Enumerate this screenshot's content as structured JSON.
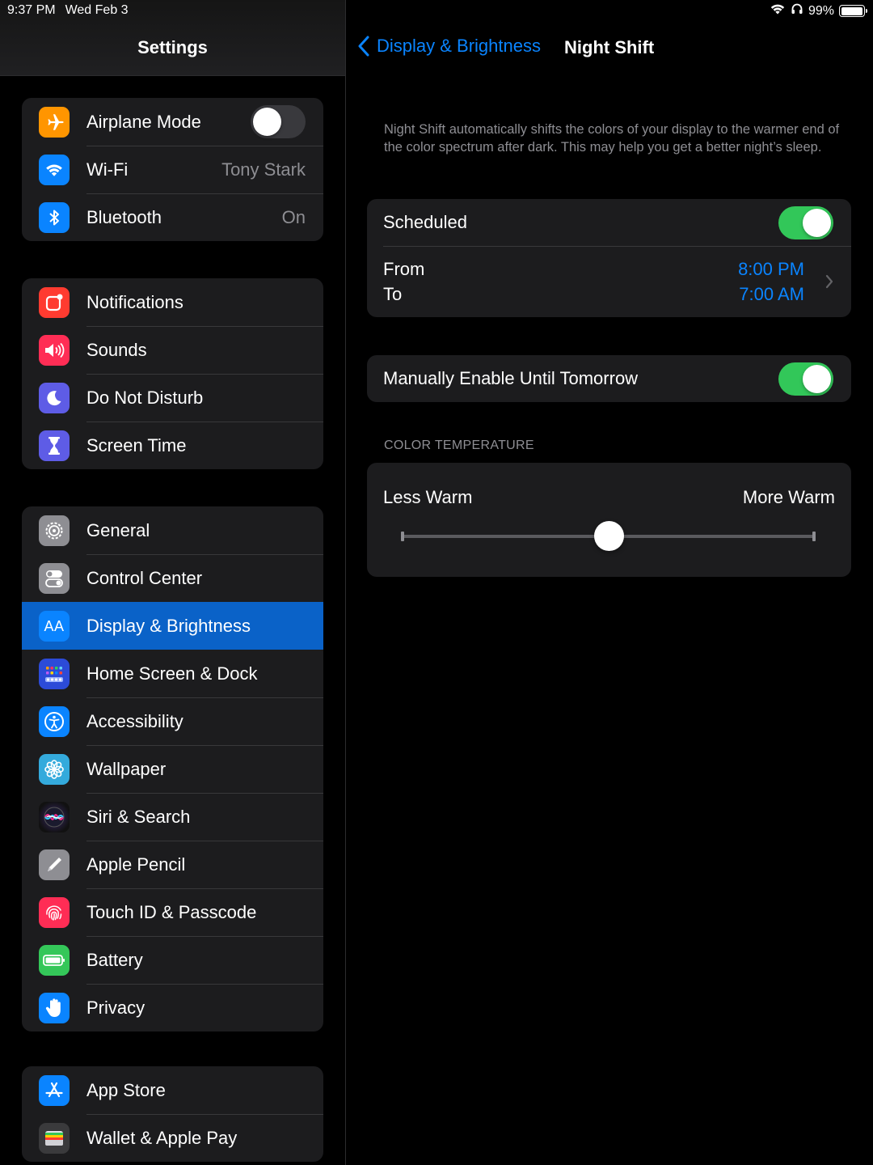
{
  "status_bar": {
    "time": "9:37 PM",
    "date": "Wed Feb 3",
    "battery": "99%",
    "battery_level": 0.99
  },
  "sidebar": {
    "title": "Settings",
    "groups": [
      {
        "items": [
          {
            "label": "Airplane Mode",
            "icon": "airplane-icon",
            "color": "#ff9500",
            "toggle": false
          },
          {
            "label": "Wi-Fi",
            "icon": "wifi-icon",
            "color": "#0a84ff",
            "value": "Tony Stark"
          },
          {
            "label": "Bluetooth",
            "icon": "bluetooth-icon",
            "color": "#0a84ff",
            "value": "On"
          }
        ]
      },
      {
        "items": [
          {
            "label": "Notifications",
            "icon": "notifications-icon",
            "color": "#ff3b30"
          },
          {
            "label": "Sounds",
            "icon": "speaker-icon",
            "color": "#ff2d55"
          },
          {
            "label": "Do Not Disturb",
            "icon": "moon-icon",
            "color": "#5e5ce6"
          },
          {
            "label": "Screen Time",
            "icon": "hourglass-icon",
            "color": "#5e5ce6"
          }
        ]
      },
      {
        "items": [
          {
            "label": "General",
            "icon": "gear-icon",
            "color": "#8e8e93"
          },
          {
            "label": "Control Center",
            "icon": "switches-icon",
            "color": "#8e8e93"
          },
          {
            "label": "Display & Brightness",
            "icon": "text-size-icon",
            "color": "#0a84ff",
            "icon_text": "AA",
            "selected": true
          },
          {
            "label": "Home Screen & Dock",
            "icon": "home-grid-icon",
            "color": "#2c4bd8"
          },
          {
            "label": "Accessibility",
            "icon": "accessibility-icon",
            "color": "#0a84ff"
          },
          {
            "label": "Wallpaper",
            "icon": "flower-icon",
            "color": "#34aadc"
          },
          {
            "label": "Siri & Search",
            "icon": "siri-icon",
            "color": "#1c1c3a"
          },
          {
            "label": "Apple Pencil",
            "icon": "pencil-icon",
            "color": "#8e8e93"
          },
          {
            "label": "Touch ID & Passcode",
            "icon": "fingerprint-icon",
            "color": "#ff2d55"
          },
          {
            "label": "Battery",
            "icon": "battery-icon",
            "color": "#34c759"
          },
          {
            "label": "Privacy",
            "icon": "hand-icon",
            "color": "#0a84ff"
          }
        ]
      },
      {
        "items": [
          {
            "label": "App Store",
            "icon": "app-store-icon",
            "color": "#0a84ff"
          },
          {
            "label": "Wallet & Apple Pay",
            "icon": "wallet-icon",
            "color": "#3a3a3c"
          }
        ]
      }
    ]
  },
  "detail": {
    "back_label": "Display & Brightness",
    "title": "Night Shift",
    "description": "Night Shift automatically shifts the colors of your display to the warmer end of the color spectrum after dark. This may help you get a better night’s sleep.",
    "scheduled": {
      "label": "Scheduled",
      "on": true
    },
    "schedule": {
      "from_label": "From",
      "to_label": "To",
      "from_value": "8:00 PM",
      "to_value": "7:00 AM"
    },
    "manual": {
      "label": "Manually Enable Until Tomorrow",
      "on": true
    },
    "color_temperature": {
      "section_label": "COLOR TEMPERATURE",
      "min_label": "Less Warm",
      "max_label": "More Warm",
      "value": 0.5
    }
  }
}
